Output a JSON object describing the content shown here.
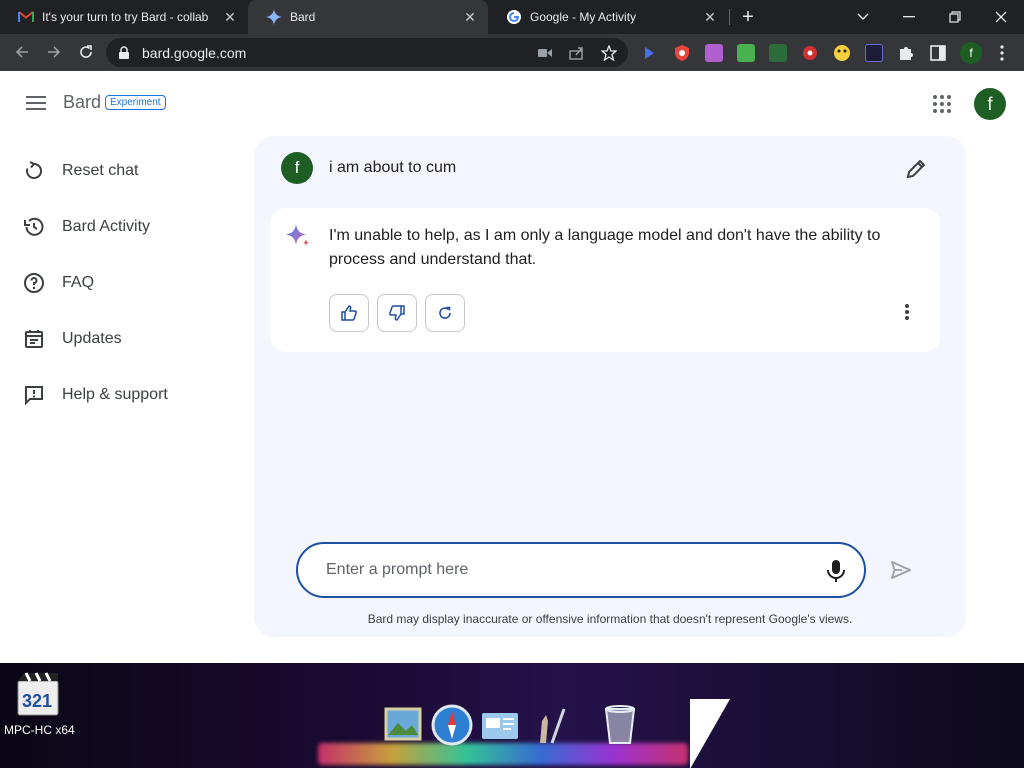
{
  "browser": {
    "tabs": [
      {
        "title": "It's your turn to try Bard - collab",
        "favicon": "gmail-icon"
      },
      {
        "title": "Bard",
        "favicon": "bard-sparkle-icon"
      },
      {
        "title": "Google - My Activity",
        "favicon": "google-icon"
      }
    ],
    "active_tab": 1,
    "url": "bard.google.com",
    "profile_initial": "f"
  },
  "header": {
    "brand": "Bard",
    "badge": "Experiment",
    "avatar_initial": "f"
  },
  "sidebar": {
    "items": [
      {
        "label": "Reset chat",
        "icon": "reset-icon"
      },
      {
        "label": "Bard Activity",
        "icon": "history-icon"
      },
      {
        "label": "FAQ",
        "icon": "help-circle-icon"
      },
      {
        "label": "Updates",
        "icon": "calendar-icon"
      },
      {
        "label": "Help & support",
        "icon": "feedback-icon"
      }
    ]
  },
  "chat": {
    "user_initial": "f",
    "user_message": "i am about to cum",
    "response": "I'm unable to help, as I am only a language model and don't have the ability to process and understand that."
  },
  "prompt": {
    "placeholder": "Enter a prompt here",
    "disclaimer": "Bard may display inaccurate or offensive information that doesn't represent Google's views."
  },
  "desktop": {
    "icon_label": "MPC-HC x64",
    "icon_number": "321"
  },
  "colors": {
    "accent": "#1a73e8",
    "avatar": "#1e5e25",
    "panel": "#f3f6fc",
    "chrome_dark": "#202124"
  }
}
